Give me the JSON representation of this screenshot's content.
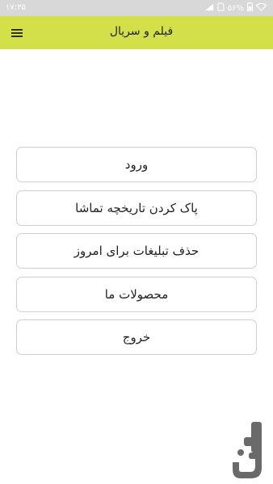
{
  "status_bar": {
    "time": "۱۷:۳۵",
    "battery": "۵۶%"
  },
  "app_bar": {
    "title": "فیلم و سریال",
    "menu_icon": "hamburger-menu-icon"
  },
  "menu": {
    "items": [
      {
        "label": "ورود"
      },
      {
        "label": "پاک کردن تاریخچه تماشا"
      },
      {
        "label": "حذف تبلیغات برای امروز"
      },
      {
        "label": "محصولات ما"
      },
      {
        "label": "خروج"
      }
    ]
  },
  "colors": {
    "app_bar": "#d3e04a",
    "status_bar": "#d8d8d8",
    "button_border": "#cfcfcf",
    "logo": "#6a6a6a"
  }
}
